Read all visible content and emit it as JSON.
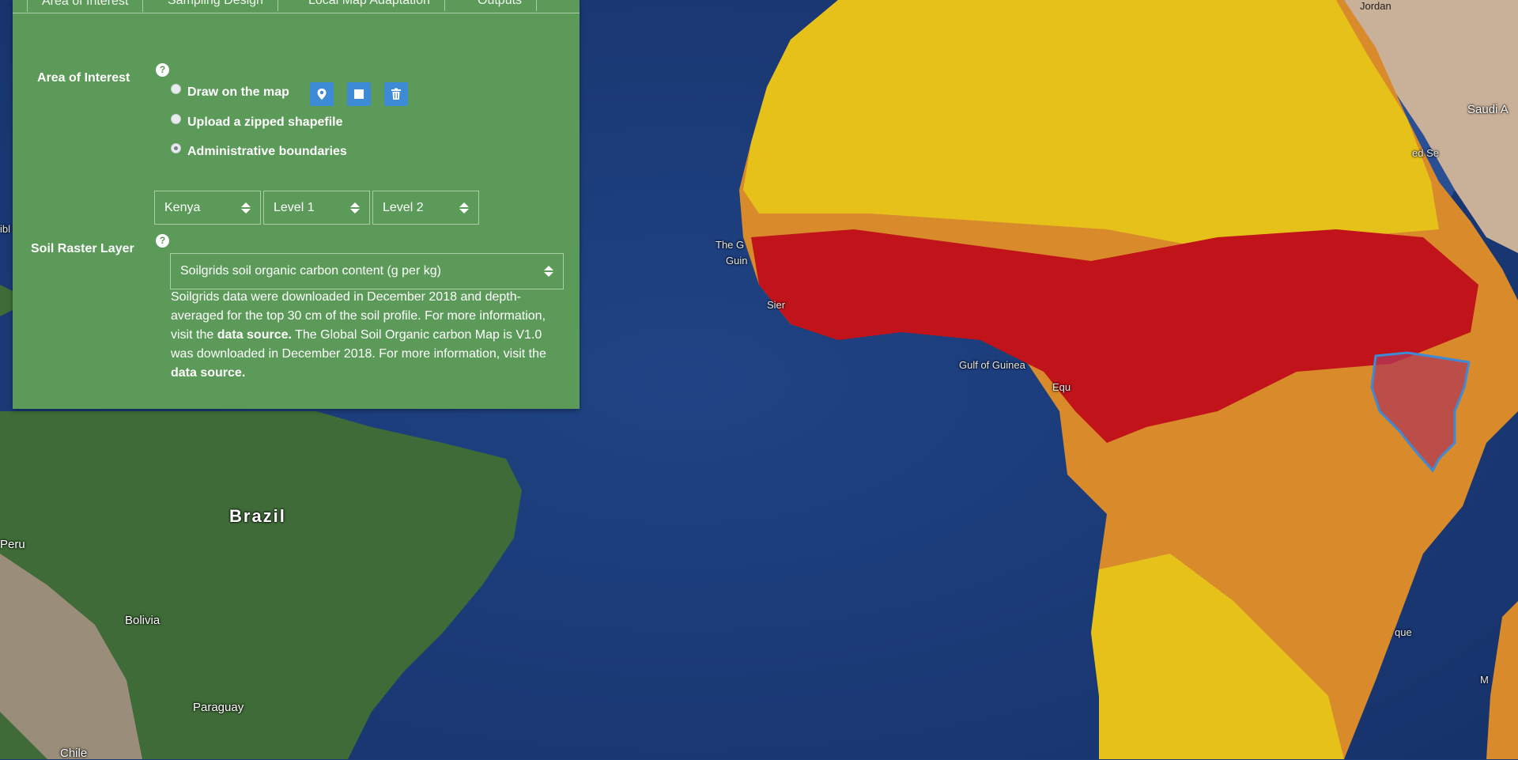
{
  "tabs": [
    {
      "label": "Area of Interest",
      "active": true
    },
    {
      "label": "Sampling Design",
      "active": false
    },
    {
      "label": "Local Map Adaptation",
      "active": false
    },
    {
      "label": "Outputs",
      "active": false
    }
  ],
  "aoi": {
    "label": "Area of Interest",
    "help": "?",
    "options": [
      {
        "label": "Draw on the map",
        "checked": false
      },
      {
        "label": "Upload a zipped shapefile",
        "checked": false
      },
      {
        "label": "Administrative boundaries",
        "checked": true
      }
    ],
    "tools": [
      "map-marker-icon",
      "square-icon",
      "trash-icon"
    ],
    "selects": {
      "country": "Kenya",
      "level1": "Level 1",
      "level2": "Level 2"
    }
  },
  "soil": {
    "label": "Soil Raster Layer",
    "help": "?",
    "selected": "Soilgrids soil organic carbon content (g per kg)",
    "desc": {
      "p1": "Soilgrids data were downloaded in December 2018 and depth-averaged for the top 30 cm of the soil profile. For more information, visit the ",
      "link1": "data source.",
      "p2": " The Global Soil Organic carbon Map is V1.0 was downloaded in December 2018. For more information, visit the ",
      "link2": "data source."
    }
  },
  "map": {
    "labels": {
      "brazil": "Brazil",
      "peru": "Peru",
      "bolivia": "Bolivia",
      "paraguay": "Paraguay",
      "chile": "Chile",
      "gulf": "Gulf of Guinea",
      "jordan": "Jordan",
      "saudi": "Saudi A",
      "redsea": "ed Se",
      "theg": "The G",
      "guin": "Guin",
      "sier": "Sier",
      "equ": "Equ",
      "que": "que",
      "ma": "M",
      "ibl": "ibl"
    },
    "colors": {
      "ocean": "#1b3a78",
      "sahara": "#e6c11a",
      "forest": "#c0131a",
      "savanna": "#d98a2a",
      "land_sa": "#3b6a35",
      "kenya_outline": "#3d8ad6"
    }
  }
}
